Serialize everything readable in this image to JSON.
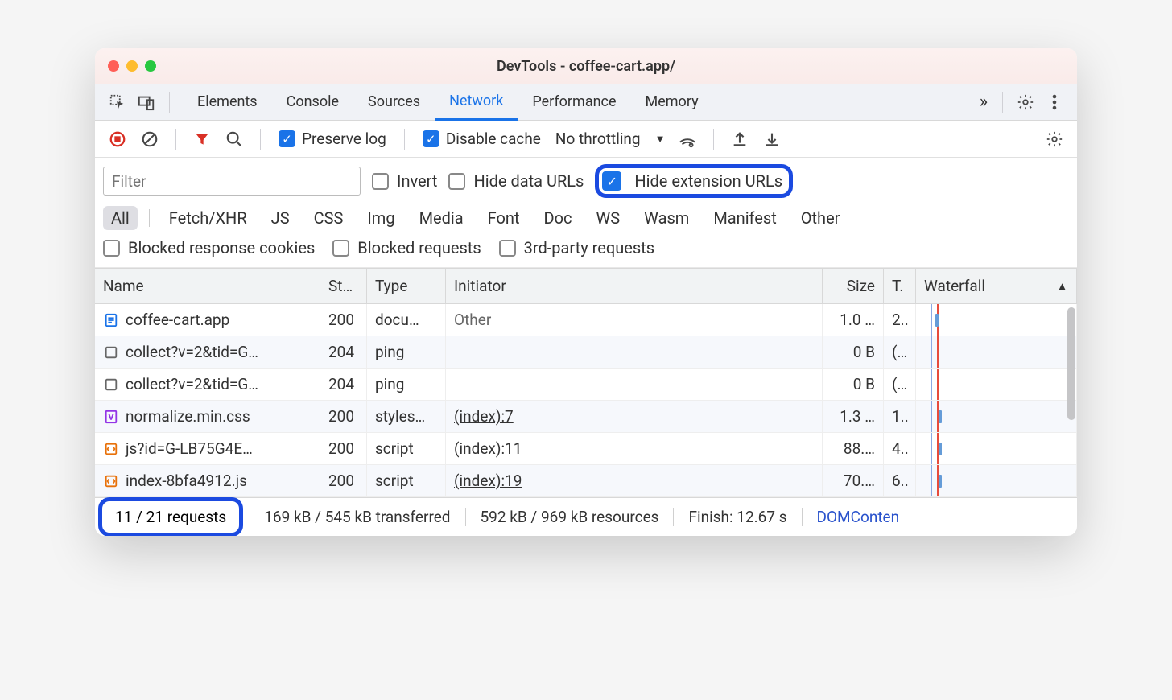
{
  "title": "DevTools - coffee-cart.app/",
  "tabs": [
    "Elements",
    "Console",
    "Sources",
    "Network",
    "Performance",
    "Memory"
  ],
  "active_tab": "Network",
  "network_bar": {
    "preserve_log": "Preserve log",
    "preserve_log_checked": true,
    "disable_cache": "Disable cache",
    "disable_cache_checked": true,
    "throttling": "No throttling"
  },
  "filter_bar": {
    "filter_placeholder": "Filter",
    "invert": "Invert",
    "invert_checked": false,
    "hide_data_urls": "Hide data URLs",
    "hide_data_urls_checked": false,
    "hide_extension_urls": "Hide extension URLs",
    "hide_extension_urls_checked": true,
    "types": [
      "All",
      "Fetch/XHR",
      "JS",
      "CSS",
      "Img",
      "Media",
      "Font",
      "Doc",
      "WS",
      "Wasm",
      "Manifest",
      "Other"
    ],
    "type_active": "All",
    "blocked_response_cookies": "Blocked response cookies",
    "blocked_response_cookies_checked": false,
    "blocked_requests": "Blocked requests",
    "blocked_requests_checked": false,
    "third_party_requests": "3rd-party requests",
    "third_party_requests_checked": false
  },
  "columns": {
    "name": "Name",
    "status": "St…",
    "type": "Type",
    "initiator": "Initiator",
    "size": "Size",
    "time": "T.",
    "waterfall": "Waterfall"
  },
  "rows": [
    {
      "icon": "doc",
      "name": "coffee-cart.app",
      "status": "200",
      "type": "docu…",
      "initiator": "Other",
      "initiator_link": false,
      "size": "1.0 …",
      "time": "2.."
    },
    {
      "icon": "ping",
      "name": "collect?v=2&tid=G…",
      "status": "204",
      "type": "ping",
      "initiator": "",
      "initiator_link": false,
      "size": "0 B",
      "time": "(…"
    },
    {
      "icon": "ping",
      "name": "collect?v=2&tid=G…",
      "status": "204",
      "type": "ping",
      "initiator": "",
      "initiator_link": false,
      "size": "0 B",
      "time": "(…"
    },
    {
      "icon": "css",
      "name": "normalize.min.css",
      "status": "200",
      "type": "styles…",
      "initiator": "(index):7",
      "initiator_link": true,
      "size": "1.3 …",
      "time": "1.."
    },
    {
      "icon": "js",
      "name": "js?id=G-LB75G4E…",
      "status": "200",
      "type": "script",
      "initiator": "(index):11",
      "initiator_link": true,
      "size": "88.…",
      "time": "4.."
    },
    {
      "icon": "js",
      "name": "index-8bfa4912.js",
      "status": "200",
      "type": "script",
      "initiator": "(index):19",
      "initiator_link": true,
      "size": "70.…",
      "time": "6.."
    }
  ],
  "status_bar": {
    "requests": "11 / 21 requests",
    "transferred": "169 kB / 545 kB transferred",
    "resources": "592 kB / 969 kB resources",
    "finish": "Finish: 12.67 s",
    "domcontent": "DOMConten"
  }
}
